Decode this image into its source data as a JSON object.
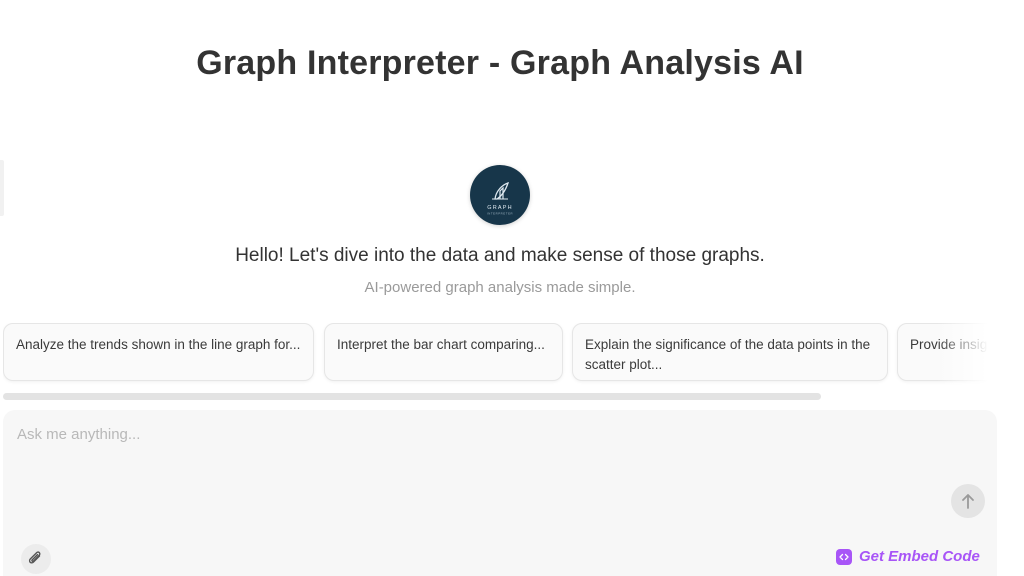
{
  "header": {
    "title": "Graph Interpreter - Graph Analysis AI"
  },
  "assistant": {
    "logo_text": "GRAPH",
    "logo_subtext": "INTERPRETER",
    "greeting": "Hello! Let's dive into the data and make sense of those graphs.",
    "subtitle": "AI-powered graph analysis made simple."
  },
  "suggestions": [
    {
      "text": "Analyze the trends shown in the line graph for..."
    },
    {
      "text": "Interpret the bar chart comparing..."
    },
    {
      "text": "Explain the significance of the data points in the scatter plot..."
    },
    {
      "text": "Provide insights of..."
    }
  ],
  "composer": {
    "placeholder": "Ask me anything...",
    "value": "",
    "send_icon": "arrow-up-icon",
    "attach_icon": "paperclip-icon",
    "embed_label": "Get Embed Code",
    "embed_icon": "code-icon"
  },
  "colors": {
    "logo_bg": "#17364a",
    "accent": "#a855f7",
    "input_bg": "#f7f7f7"
  }
}
